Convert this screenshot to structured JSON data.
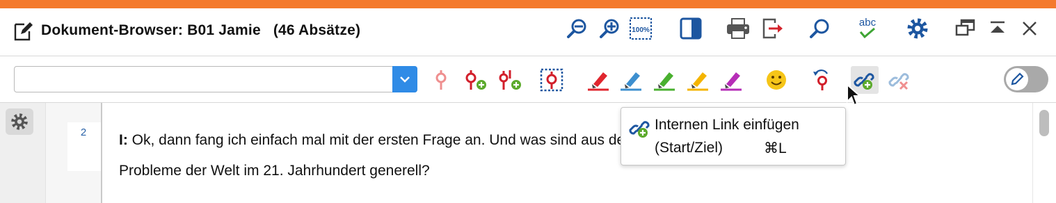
{
  "window": {
    "title": "Dokument-Browser: B01 Jamie",
    "paragraph_count": "(46 Absätze)",
    "accent_color": "#f47a2d"
  },
  "title_icons": [
    "zoom-out-icon",
    "zoom-in-icon",
    "zoom-100-icon",
    "panel-icon",
    "print-icon",
    "export-icon",
    "search-icon",
    "spellcheck-icon",
    "gear-icon",
    "undock-icon",
    "collapse-icon",
    "close-icon"
  ],
  "spellcheck_label": "abc",
  "zoom100_label": "100%",
  "toolbar": {
    "search": {
      "value": "",
      "placeholder": ""
    },
    "icons": [
      "code-icon",
      "code-add-icon",
      "code-multi-add-icon",
      "code-select-icon",
      "highlighter-red-icon",
      "highlighter-blue-icon",
      "highlighter-green-icon",
      "highlighter-yellow-icon",
      "highlighter-purple-icon",
      "emoticon-icon",
      "code-undo-icon",
      "link-insert-icon",
      "link-delete-icon"
    ],
    "edit_toggle": {
      "on": false,
      "icon": "pencil-icon"
    }
  },
  "paragraph": {
    "number": "2",
    "speaker": "I:",
    "line1": "Ok, dann fang ich einfach mal mit der ersten Frage an. Und was sind aus deiner Sicht die größten",
    "line2": "Probleme der Welt im 21. Jahrhundert generell?"
  },
  "tooltip": {
    "title": "Internen Link einfügen",
    "subtitle": "(Start/Ziel)",
    "shortcut": "⌘L"
  }
}
